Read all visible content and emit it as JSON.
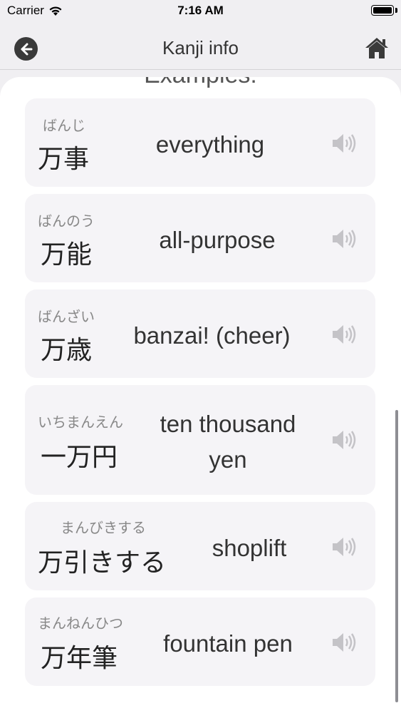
{
  "status": {
    "carrier": "Carrier",
    "time": "7:16 AM"
  },
  "nav": {
    "title": "Kanji info"
  },
  "section": {
    "title": "Examples:"
  },
  "examples": [
    {
      "reading": "ばんじ",
      "kanji": "万事",
      "meaning_lines": [
        "everything"
      ]
    },
    {
      "reading": "ばんのう",
      "kanji": "万能",
      "meaning_lines": [
        "all-purpose"
      ]
    },
    {
      "reading": "ばんざい",
      "kanji": "万歳",
      "meaning_lines": [
        "banzai! (cheer)"
      ]
    },
    {
      "reading": "いちまんえん",
      "kanji": "一万円",
      "meaning_lines": [
        "ten thousand",
        "yen"
      ]
    },
    {
      "reading": "まんびきする",
      "kanji": "万引きする",
      "meaning_lines": [
        "shoplift"
      ]
    },
    {
      "reading": "まんねんひつ",
      "kanji": "万年筆",
      "meaning_lines": [
        "fountain pen"
      ]
    }
  ],
  "icons": {
    "back": "back-arrow-icon",
    "home": "home-icon",
    "speaker": "speaker-icon",
    "wifi": "wifi-icon",
    "battery": "battery-icon"
  }
}
